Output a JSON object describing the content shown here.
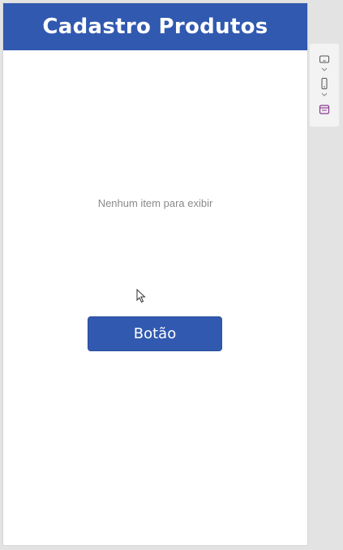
{
  "header": {
    "title": "Cadastro Produtos"
  },
  "gallery": {
    "empty_message": "Nenhum item para exibir"
  },
  "button": {
    "label": "Botão"
  },
  "side_panel": {
    "icons": [
      "tablet-landscape-icon",
      "chevron-down-icon",
      "phone-icon",
      "chevron-down-icon",
      "calendar-icon"
    ]
  },
  "colors": {
    "header_bg": "#3159b0",
    "button_bg": "#3159b0",
    "accent_icon": "#8b3a8f"
  }
}
